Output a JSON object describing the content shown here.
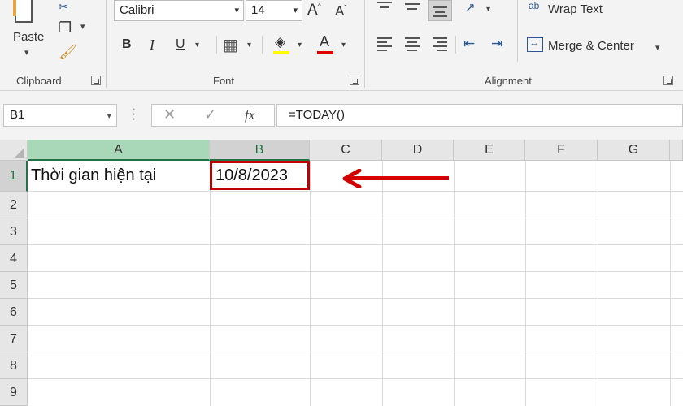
{
  "ribbon": {
    "clipboard": {
      "paste_label": "Paste",
      "group_label": "Clipboard"
    },
    "font": {
      "font_name": "Calibri",
      "font_size": "14",
      "grow_glyph": "A",
      "shrink_glyph": "A",
      "bold": "B",
      "italic": "I",
      "underline": "U",
      "font_color_glyph": "A",
      "group_label": "Font",
      "highlight_color": "#ffff00",
      "font_color": "#e00000"
    },
    "alignment": {
      "wrap_text_label": "Wrap Text",
      "wrap_icon_glyph": "ab",
      "merge_label": "Merge & Center",
      "group_label": "Alignment"
    }
  },
  "formula_bar": {
    "name_box": "B1",
    "cancel_glyph": "✕",
    "enter_glyph": "✓",
    "fx": "fx",
    "formula": "=TODAY()"
  },
  "sheet": {
    "columns": [
      "A",
      "B",
      "C",
      "D",
      "E",
      "F",
      "G"
    ],
    "rows": [
      "1",
      "2",
      "3",
      "4",
      "5",
      "6",
      "7",
      "8",
      "9"
    ],
    "selected_cell": "B1",
    "cells": {
      "A1": "Thời gian hiện tại",
      "B1": "10/8/2023"
    },
    "accent_color": "#217346",
    "annotation_color": "#c00000"
  }
}
